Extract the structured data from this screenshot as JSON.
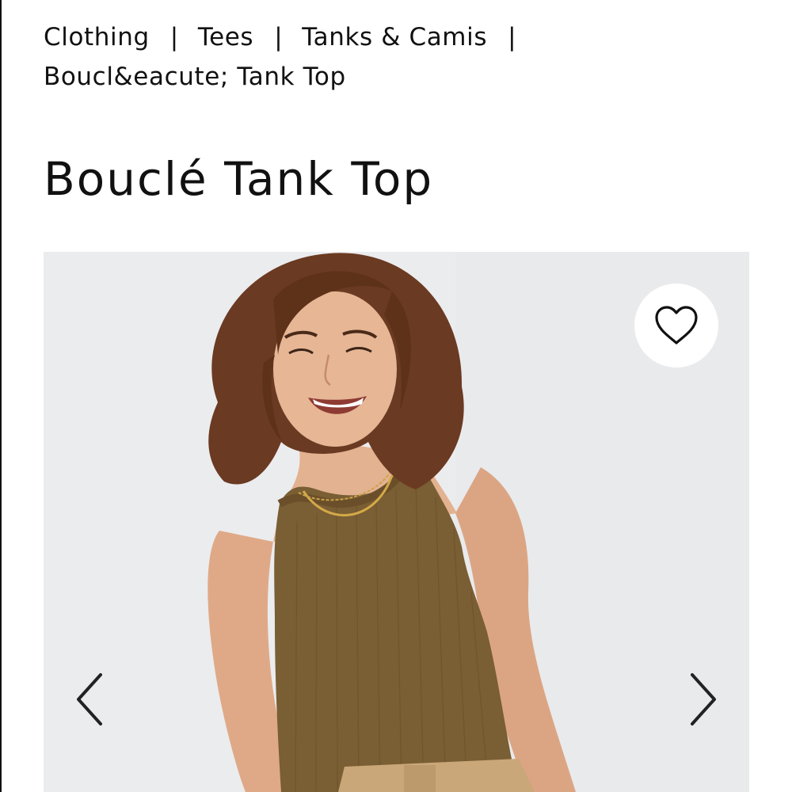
{
  "breadcrumb": {
    "items": [
      {
        "label": "Clothing"
      },
      {
        "label": "Tees"
      },
      {
        "label": "Tanks & Camis"
      },
      {
        "label": "Boucl&eacute; Tank Top"
      }
    ],
    "separator": "|"
  },
  "product": {
    "title": "Bouclé Tank Top"
  },
  "gallery": {
    "favorite_icon": "heart-outline-icon",
    "prev_icon": "chevron-left-icon",
    "next_icon": "chevron-right-icon"
  },
  "colors": {
    "text": "#111111",
    "image_background": "#ebecee",
    "tank_top": "#7a5e34",
    "hair": "#6b3a22",
    "skin": "#e2b08d",
    "pants": "#c9a779"
  }
}
